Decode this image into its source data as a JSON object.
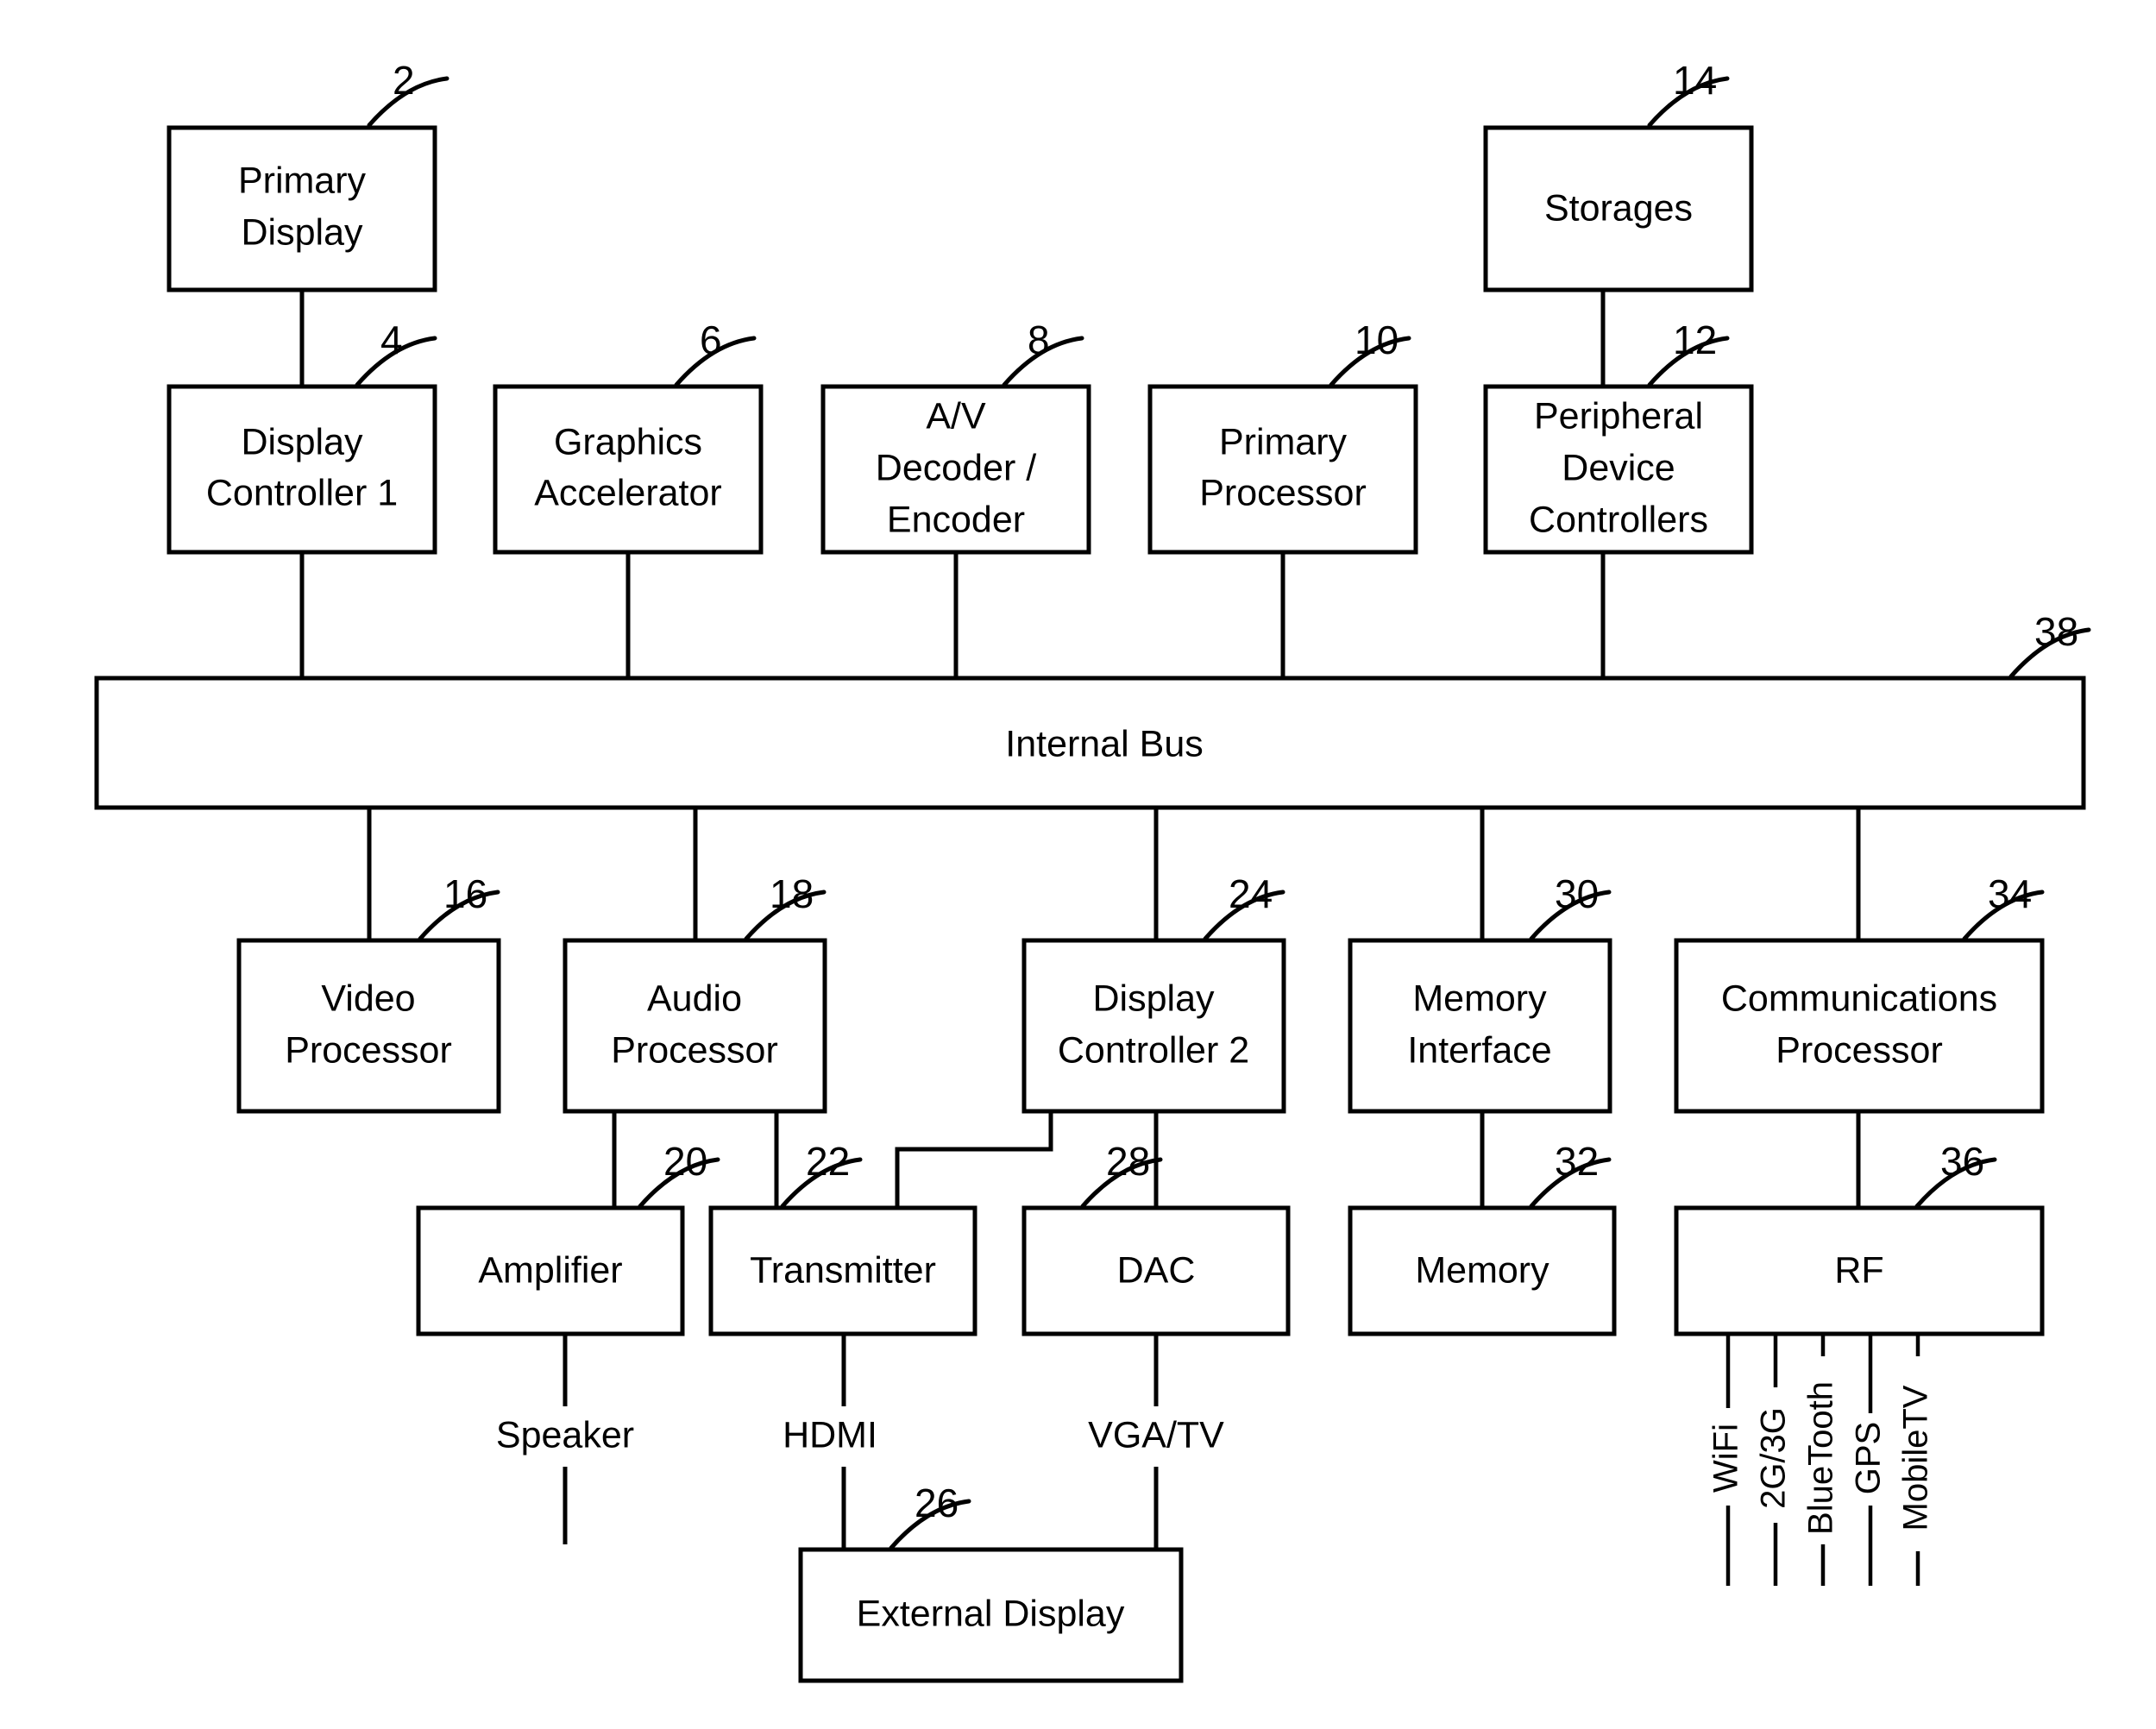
{
  "diagram": {
    "title": "System block diagram",
    "stroke_color": "#000000",
    "background_color": "#ffffff",
    "blocks": [
      {
        "id": "primary_display",
        "label": "Primary\nDisplay",
        "ref": "2",
        "lines": [
          "Primary",
          "Display"
        ]
      },
      {
        "id": "display_controller_1",
        "label": "Display\nController 1",
        "ref": "4",
        "lines": [
          "Display",
          "Controller 1"
        ]
      },
      {
        "id": "graphics_accelerator",
        "label": "Graphics\nAccelerator",
        "ref": "6",
        "lines": [
          "Graphics",
          "Accelerator"
        ]
      },
      {
        "id": "av_decoder_encoder",
        "label": "A/V\nDecoder /\nEncoder",
        "ref": "8",
        "lines": [
          "A/V",
          "Decoder /",
          "Encoder"
        ]
      },
      {
        "id": "primary_processor",
        "label": "Primary\nProcessor",
        "ref": "10",
        "lines": [
          "Primary",
          "Processor"
        ]
      },
      {
        "id": "peripheral_device_controllers",
        "label": "Peripheral\nDevice\nControllers",
        "ref": "12",
        "lines": [
          "Peripheral",
          "Device",
          "Controllers"
        ]
      },
      {
        "id": "storages",
        "label": "Storages",
        "ref": "14",
        "lines": [
          "Storages"
        ]
      },
      {
        "id": "internal_bus",
        "label": "Internal Bus",
        "ref": "38",
        "lines": [
          "Internal Bus"
        ]
      },
      {
        "id": "video_processor",
        "label": "Video\nProcessor",
        "ref": "16",
        "lines": [
          "Video",
          "Processor"
        ]
      },
      {
        "id": "audio_processor",
        "label": "Audio\nProcessor",
        "ref": "18",
        "lines": [
          "Audio",
          "Processor"
        ]
      },
      {
        "id": "display_controller_2",
        "label": "Display\nController 2",
        "ref": "24",
        "lines": [
          "Display",
          "Controller 2"
        ]
      },
      {
        "id": "memory_interface",
        "label": "Memory\nInterface",
        "ref": "30",
        "lines": [
          "Memory",
          "Interface"
        ]
      },
      {
        "id": "communications_processor",
        "label": "Communications\nProcessor",
        "ref": "34",
        "lines": [
          "Communications",
          "Processor"
        ]
      },
      {
        "id": "amplifier",
        "label": "Amplifier",
        "ref": "20",
        "lines": [
          "Amplifier"
        ]
      },
      {
        "id": "transmitter",
        "label": "Transmitter",
        "ref": "22",
        "lines": [
          "Transmitter"
        ]
      },
      {
        "id": "dac",
        "label": "DAC",
        "ref": "28",
        "lines": [
          "DAC"
        ]
      },
      {
        "id": "memory",
        "label": "Memory",
        "ref": "32",
        "lines": [
          "Memory"
        ]
      },
      {
        "id": "rf",
        "label": "RF",
        "ref": "36",
        "lines": [
          "RF"
        ]
      },
      {
        "id": "external_display",
        "label": "External Display",
        "ref": "26",
        "lines": [
          "External Display"
        ]
      }
    ],
    "port_labels": [
      {
        "id": "speaker",
        "label": "Speaker"
      },
      {
        "id": "hdmi",
        "label": "HDMI"
      },
      {
        "id": "vga_tv",
        "label": "VGA/TV"
      }
    ],
    "rf_interfaces": [
      {
        "id": "wifi",
        "label": "WiFi"
      },
      {
        "id": "2g3g",
        "label": "2G/3G"
      },
      {
        "id": "bluetooth",
        "label": "BlueTooth"
      },
      {
        "id": "gps",
        "label": "GPS"
      },
      {
        "id": "mobiletv",
        "label": "MobileTV"
      }
    ],
    "texts": {
      "primary_display_l1": "Primary",
      "primary_display_l2": "Display",
      "display_controller_1_l1": "Display",
      "display_controller_1_l2": "Controller 1",
      "graphics_accelerator_l1": "Graphics",
      "graphics_accelerator_l2": "Accelerator",
      "av_l1": "A/V",
      "av_l2": "Decoder /",
      "av_l3": "Encoder",
      "primary_processor_l1": "Primary",
      "primary_processor_l2": "Processor",
      "pdc_l1": "Peripheral",
      "pdc_l2": "Device",
      "pdc_l3": "Controllers",
      "storages_l1": "Storages",
      "internal_bus_l1": "Internal Bus",
      "video_processor_l1": "Video",
      "video_processor_l2": "Processor",
      "audio_processor_l1": "Audio",
      "audio_processor_l2": "Processor",
      "display_controller_2_l1": "Display",
      "display_controller_2_l2": "Controller 2",
      "memory_interface_l1": "Memory",
      "memory_interface_l2": "Interface",
      "comm_processor_l1": "Communications",
      "comm_processor_l2": "Processor",
      "amplifier_l1": "Amplifier",
      "transmitter_l1": "Transmitter",
      "dac_l1": "DAC",
      "memory_l1": "Memory",
      "rf_l1": "RF",
      "external_display_l1": "External Display",
      "speaker": "Speaker",
      "hdmi": "HDMI",
      "vga_tv": "VGA/TV",
      "wifi": "WiFi",
      "g2g3": "2G/3G",
      "bluetooth": "BlueTooth",
      "gps": "GPS",
      "mobiletv": "MobileTV"
    },
    "refs": {
      "primary_display": "2",
      "display_controller_1": "4",
      "graphics_accelerator": "6",
      "av_decoder_encoder": "8",
      "primary_processor": "10",
      "peripheral_device_controllers": "12",
      "storages": "14",
      "video_processor": "16",
      "audio_processor": "18",
      "amplifier": "20",
      "transmitter": "22",
      "display_controller_2": "24",
      "external_display": "26",
      "dac": "28",
      "memory_interface": "30",
      "memory": "32",
      "communications_processor": "34",
      "rf": "36",
      "internal_bus": "38"
    }
  }
}
